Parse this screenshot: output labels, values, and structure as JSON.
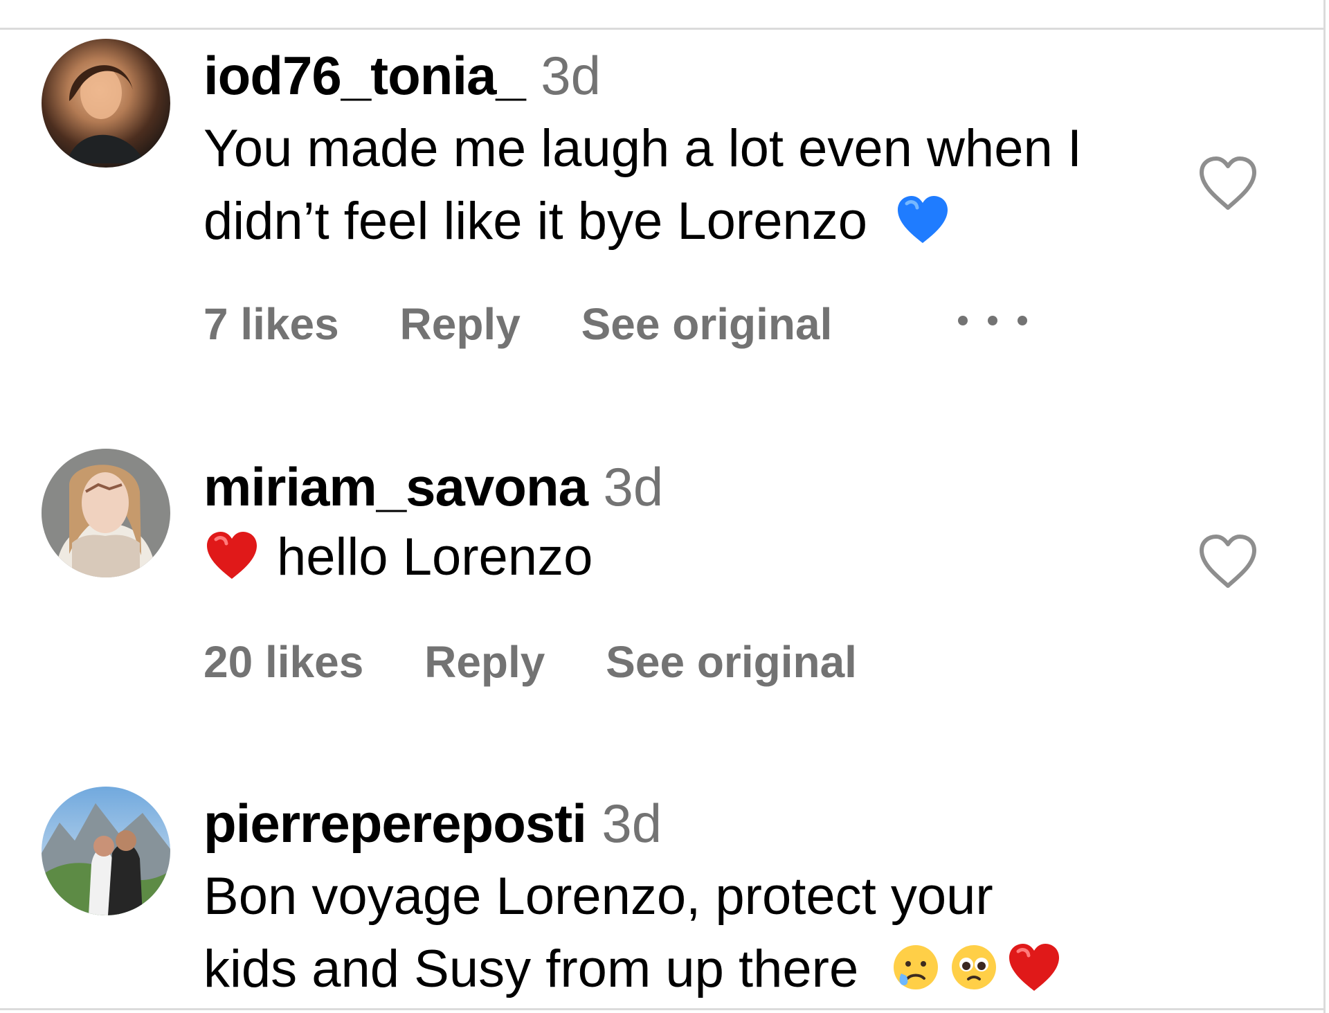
{
  "comments": [
    {
      "username": "iod76_tonia_",
      "time": "3d",
      "text_line_1": "You made me laugh a lot even when I",
      "text_line_2": "didn’t feel like it bye Lorenzo",
      "emoji": "blue-heart-emoji",
      "likes": "7 likes",
      "reply": "Reply",
      "see_original": "See original",
      "more": "more-options-icon"
    },
    {
      "username": "miriam_savona",
      "time": "3d",
      "text_prefix_emoji": "red-heart-emoji",
      "text": "hello Lorenzo",
      "likes": "20 likes",
      "reply": "Reply",
      "see_original": "See original"
    },
    {
      "username": "pierrepereposti",
      "time": "3d",
      "text_line_1": "Bon voyage Lorenzo, protect your",
      "text_line_2": "kids and Susy from up there",
      "emojis": [
        "crying-face-emoji",
        "pleading-face-emoji",
        "red-heart-emoji"
      ]
    }
  ],
  "icons": {
    "like": "heart-outline-icon"
  },
  "colors": {
    "text_primary": "#000000",
    "text_secondary": "#737373",
    "divider": "#dbdbdb",
    "blue_heart": "#1f7cff",
    "red_heart": "#e01919"
  }
}
